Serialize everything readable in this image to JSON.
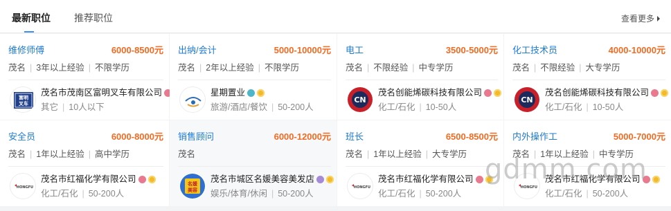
{
  "tabs": {
    "latest": "最新职位",
    "recommended": "推荐职位",
    "more": "查看更多"
  },
  "jobs": [
    {
      "title": "维修师傅",
      "salary": "6000-8500元",
      "location": "茂名",
      "experience": "3年以上经验",
      "education": "不限学历",
      "company": "茂名市茂南区富明叉车有限公司",
      "industry": "其它",
      "size": "10人以下",
      "logo_text": "富明叉车",
      "badges": [
        "pink"
      ]
    },
    {
      "title": "出纳/会计",
      "salary": "5000-10000元",
      "location": "茂名",
      "experience": "2年以上经验",
      "education": "不限学历",
      "company": "星期置业",
      "industry": "旅游/酒店/餐饮",
      "size": "50-200人",
      "logo_text": "",
      "badges": [
        "teal",
        "gold"
      ]
    },
    {
      "title": "电工",
      "salary": "3500-5000元",
      "location": "茂名",
      "experience": "不限经验",
      "education": "中专学历",
      "company": "茂名创能烯碳科技有限公司",
      "industry": "化工/石化",
      "size": "10-50人",
      "logo_text": "CN",
      "badges": [
        "pink",
        "gold"
      ]
    },
    {
      "title": "化工技术员",
      "salary": "4000-10000元",
      "location": "茂名",
      "experience": "不限经验",
      "education": "大专学历",
      "company": "茂名创能烯碳科技有限公司",
      "industry": "化工/石化",
      "size": "10-50人",
      "logo_text": "CN",
      "badges": [
        "pink",
        "gold"
      ]
    },
    {
      "title": "安全员",
      "salary": "6000-8000元",
      "location": "茂名",
      "experience": "1年以上经验",
      "education": "高中学历",
      "company": "茂名市红福化学有限公司",
      "industry": "化工/石化",
      "size": "50-200人",
      "logo_text": "HONGFU",
      "badges": [
        "pink",
        "gold"
      ]
    },
    {
      "title": "销售顾问",
      "salary": "6000-12000元",
      "location": "茂名",
      "experience": "",
      "education": "",
      "company": "茂名市城区名媛美容美发店",
      "industry": "娱乐/体育/休闲",
      "size": "50-200人",
      "logo_text": "名媛美容",
      "badges": [
        "purple",
        "gold"
      ]
    },
    {
      "title": "班长",
      "salary": "6500-8500元",
      "location": "茂名",
      "experience": "1年以上经验",
      "education": "大专学历",
      "company": "茂名市红福化学有限公司",
      "industry": "化工/石化",
      "size": "50-200人",
      "logo_text": "HONGFU",
      "badges": [
        "pink",
        "gold"
      ]
    },
    {
      "title": "内外操作工",
      "salary": "5000-7000元",
      "location": "茂名",
      "experience": "1年以上经验",
      "education": "中专学历",
      "company": "茂名市红福化学有限公司",
      "industry": "化工/石化",
      "size": "50-200人",
      "logo_text": "HONGFU",
      "badges": [
        "pink",
        "gold"
      ]
    }
  ],
  "watermark": "gdmm.com",
  "colors": {
    "title_blue": "#1e7bd6",
    "salary_orange": "#f26b22",
    "tab_accent": "#3d8ff0"
  }
}
